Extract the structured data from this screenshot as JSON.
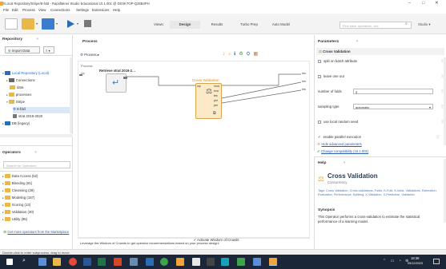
{
  "window": {
    "title": "//Local Repository/Stripe/8-fold - RapidMiner Studio Educational 10.1.001 @ DESKTOP-Q28B4PH",
    "min": "–",
    "max": "□",
    "close": "✕"
  },
  "menu": [
    "File",
    "Edit",
    "Process",
    "View",
    "Connections",
    "Settings",
    "Extensions",
    "Help"
  ],
  "toolbar": {
    "views_label": "Views:",
    "views": [
      "Design",
      "Results",
      "Turbo Prep",
      "Auto Model"
    ],
    "search_placeholder": "Find data, operators...etc",
    "user": "Studio ▾"
  },
  "repository": {
    "title": "Repository",
    "import_btn": "Import Data",
    "items": [
      "Local Repository (Local)",
      "Connections",
      "data",
      "processes",
      "Stripe",
      "8-fold",
      "strat 2019-2020",
      "DB (legacy)"
    ]
  },
  "operators": {
    "title": "Operators",
    "search_placeholder": "Search for Operators",
    "items": [
      "Data Access (52)",
      "Blending (81)",
      "Cleansing (28)",
      "Modeling (157)",
      "Scoring (13)",
      "Validation (30)",
      "Utility (95)"
    ],
    "get_more": "Get more operators from the Marketplace"
  },
  "process": {
    "title": "Process",
    "breadcrumb": "Process ▸",
    "label": "Process",
    "retrieve": "Retrieve strat 2019-2…",
    "cv": "Cross Validation",
    "port_in": "inp",
    "port_out": [
      "mod",
      "exa",
      "tes",
      "per",
      "per"
    ],
    "port_res": [
      "res",
      "res",
      "res"
    ],
    "crowd_text": "Leverage the Wisdom of Crowds to get operator recommendations based on your process design!",
    "crowd_btn": "Activate Wisdom of Crowds"
  },
  "parameters": {
    "title": "Parameters",
    "op_name": "Cross Validation",
    "rows": [
      {
        "type": "check",
        "label": "split on batch attribute"
      },
      {
        "type": "check",
        "label": "leave one out"
      },
      {
        "type": "input",
        "label": "number of folds",
        "value": "5"
      },
      {
        "type": "select",
        "label": "sampling type",
        "value": "automatic"
      },
      {
        "type": "check",
        "label": "use local random seed"
      },
      {
        "type": "check",
        "label": "enable parallel execution"
      }
    ],
    "hide_adv": "Hide advanced parameters",
    "change_compat": "Change compatibility (10.1.001)"
  },
  "help": {
    "title": "Help",
    "op_name": "Cross Validation",
    "category": "Concurrency",
    "tags": "Tags: Cross Validation, Cross-validations, Folds, K-Fold, K-folds, Validations, Estimation, Evaluation, Performance, Splitting, X-Validation, X-Prediction, Validation",
    "synopsis_title": "Synopsis",
    "synopsis": "This Operator performs a cross-validation to estimate the statistical performance of a learning model."
  },
  "statusbar": {
    "text": "Double-click to enter subprocess, drag to move."
  },
  "taskbar": {
    "time": "18:38",
    "date": "05/12/2023"
  },
  "colors": {
    "accent": "#2d6bb3",
    "cv_orange": "#f2a33a",
    "taskbar": "#1b2738",
    "green": "#3ea34a"
  }
}
